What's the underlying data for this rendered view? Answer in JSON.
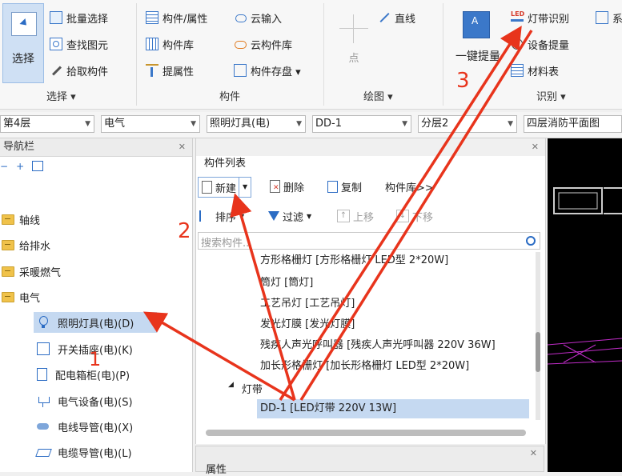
{
  "ribbon": {
    "select_group": {
      "big_button": "选择",
      "batch_select": "批量选择",
      "find_element": "查找图元",
      "pick_component": "拾取构件",
      "label": "选择 ▾"
    },
    "component_group": {
      "component_props": "构件/属性",
      "component_lib": "构件库",
      "extract_props": "提属性",
      "cloud_input": "云输入",
      "cloud_lib": "云构件库",
      "component_store": "构件存盘 ▾",
      "label": "构件"
    },
    "draw_group": {
      "point": "点",
      "line": "直线",
      "label": "绘图 ▾"
    },
    "identify_group": {
      "one_click": "一键提量",
      "light_strip": "灯带识别",
      "equip_extract": "设备提量",
      "material_table": "材料表",
      "label": "识别 ▾",
      "cut_off": "系"
    }
  },
  "combos": [
    "第4层",
    "电气",
    "照明灯具(电)",
    "DD-1",
    "分层2",
    "四层消防平面图"
  ],
  "nav": {
    "title": "导航栏",
    "categories": [
      "轴线",
      "给排水",
      "采暖燃气",
      "电气"
    ],
    "items": [
      "照明灯具(电)(D)",
      "开关插座(电)(K)",
      "配电箱柜(电)(P)",
      "电气设备(电)(S)",
      "电线导管(电)(X)",
      "电缆导管(电)(L)"
    ]
  },
  "component_list": {
    "title": "构件列表",
    "new_btn": "新建",
    "delete_btn": "删除",
    "copy_btn": "复制",
    "lib_btn": "构件库>>",
    "sort_btn": "排序",
    "filter_btn": "过滤",
    "up_btn": "上移",
    "down_btn": "下移",
    "search_placeholder": "搜索构件...",
    "items": [
      "方形格栅灯 [方形格栅灯 LED型 2*20W]",
      "筒灯 [筒灯]",
      "工艺吊灯 [工艺吊灯]",
      "发光灯膜 [发光灯膜]",
      "残疾人声光呼叫器 [残疾人声光呼叫器 220V 36W]",
      "加长形格栅灯 [加长形格栅灯 LED型 2*20W]"
    ],
    "group_label": "灯带",
    "selected_item": "DD-1 [LED灯带 220V 13W]"
  },
  "props": {
    "title": "属性"
  },
  "annotations": {
    "n1": "1",
    "n2": "2",
    "n3": "3",
    "color": "#e8341c"
  },
  "colors": {
    "selection": "#c5d9f1",
    "accent": "#2b6cc4",
    "canvas": "#000000",
    "magenta": "#c02cc8"
  }
}
